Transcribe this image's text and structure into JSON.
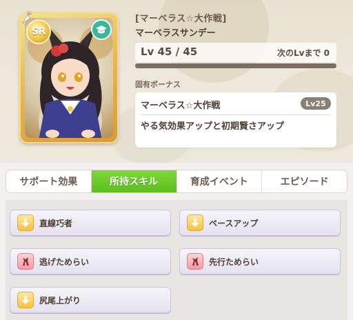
{
  "card": {
    "rarity": "SR",
    "type_icon": "graduation-cap-icon",
    "corner_icon": "carrot-icon",
    "frame_color": "#e9b955"
  },
  "header": {
    "epithet": "[マーベラス☆大作戦]",
    "name": "マーベラスサンデー",
    "level_text": "Lv 45 / 45",
    "next_level_text": "次のLvまで 0",
    "level_progress": 1.0
  },
  "bonus": {
    "section_label": "固有ボーナス",
    "name": "マーベラス☆大作戦",
    "level_badge": "Lv25",
    "description": "やる気効果アップと初期賢さアップ"
  },
  "tabs": [
    {
      "label": "サポート効果",
      "active": false
    },
    {
      "label": "所持スキル",
      "active": true
    },
    {
      "label": "育成イベント",
      "active": false
    },
    {
      "label": "エピソード",
      "active": false
    }
  ],
  "skills": [
    {
      "label": "直線巧者",
      "icon": "speed-up-icon",
      "color": "gold"
    },
    {
      "label": "ペースアップ",
      "icon": "speed-up-icon",
      "color": "gold"
    },
    {
      "label": "逃げためらい",
      "icon": "horse-debuff-icon",
      "color": "red"
    },
    {
      "label": "先行ためらい",
      "icon": "horse-debuff-icon",
      "color": "red"
    },
    {
      "label": "尻尾上がり",
      "icon": "speed-up-icon",
      "color": "gold"
    }
  ],
  "colors": {
    "active_tab": "#5cbd1e",
    "skill_gold": "#f5c23f",
    "skill_red": "#f19ba4"
  }
}
